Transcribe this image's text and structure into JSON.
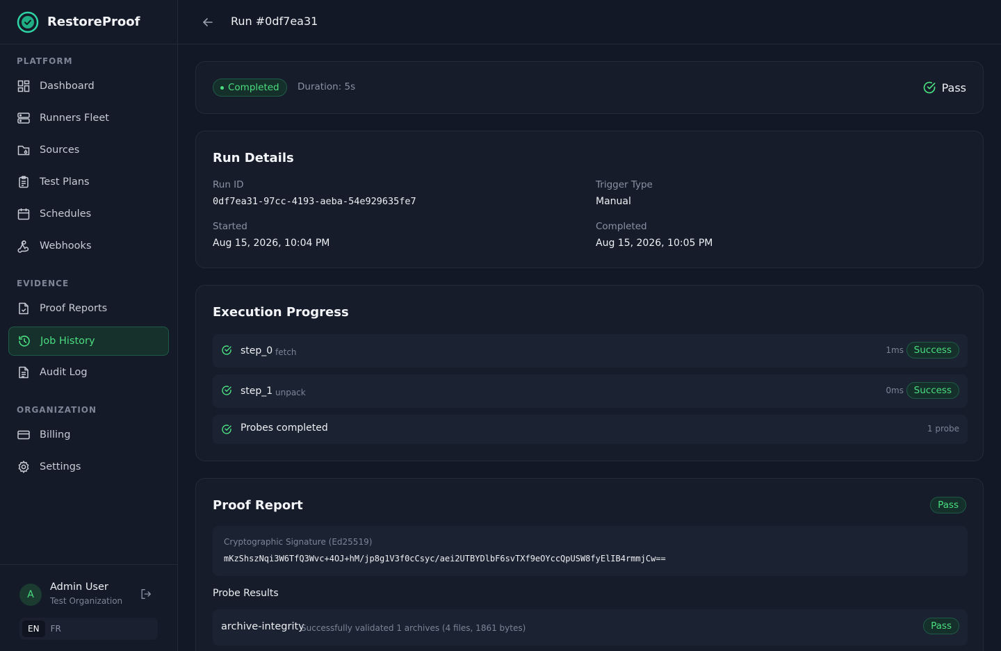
{
  "brand": {
    "name": "RestoreProof"
  },
  "sidebar": {
    "sections": {
      "platform": "PLATFORM",
      "evidence": "EVIDENCE",
      "organization": "ORGANIZATION"
    },
    "items": {
      "dashboard": "Dashboard",
      "runners": "Runners Fleet",
      "sources": "Sources",
      "test_plans": "Test Plans",
      "schedules": "Schedules",
      "webhooks": "Webhooks",
      "proof_reports": "Proof Reports",
      "job_history": "Job History",
      "audit_log": "Audit Log",
      "billing": "Billing",
      "settings": "Settings"
    },
    "active_item": "Job History"
  },
  "user": {
    "initial": "A",
    "name": "Admin User",
    "org": "Test Organization"
  },
  "language": {
    "options": [
      "EN",
      "FR"
    ],
    "selected": "EN"
  },
  "header": {
    "title": "Run #0df7ea31"
  },
  "summary": {
    "status": "Completed",
    "duration": "Duration: 5s",
    "result": "Pass"
  },
  "run_details": {
    "title": "Run Details",
    "run_id_label": "Run ID",
    "run_id": "0df7ea31-97cc-4193-aeba-54e929635fe7",
    "trigger_label": "Trigger Type",
    "trigger": "Manual",
    "started_label": "Started",
    "started": "Aug 15, 2026, 10:04 PM",
    "completed_label": "Completed",
    "completed": "Aug 15, 2026, 10:05 PM"
  },
  "execution": {
    "title": "Execution Progress",
    "steps": [
      {
        "name": "step_0",
        "type": "fetch",
        "duration": "1ms",
        "status": "Success"
      },
      {
        "name": "step_1",
        "type": "unpack",
        "duration": "0ms",
        "status": "Success"
      }
    ],
    "probes": {
      "label": "Probes completed",
      "count": "1 probe"
    }
  },
  "proof_report": {
    "title": "Proof Report",
    "result": "Pass",
    "signature_label": "Cryptographic Signature (Ed25519)",
    "signature": "mKzShszNqi3W6TfQ3Wvc+4OJ+hM/jp8g1V3f0cCsyc/aei2UTBYDlbF6svTXf9eOYccQpUSW8fyElIB4rmmjCw==",
    "probe_results_label": "Probe Results",
    "probes": [
      {
        "name": "archive-integrity",
        "description": "Successfully validated 1 archives (4 files, 1861 bytes)",
        "result": "Pass"
      }
    ]
  },
  "colors": {
    "accent": "#4ade80",
    "background": "#131826",
    "card": "#161c2a"
  }
}
